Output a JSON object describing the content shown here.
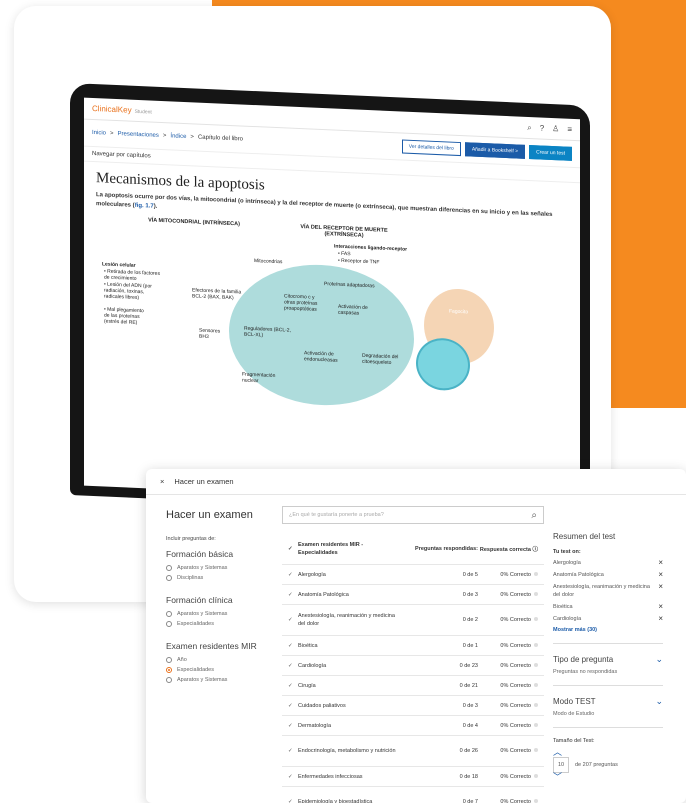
{
  "colors": {
    "orange": "#f58a1f",
    "link": "#1b5ba8",
    "brand": "#e9711c"
  },
  "laptop": {
    "brand": "ClinicalKey",
    "brand_sub": "Student",
    "crumbs": [
      "Inicio",
      ">",
      "Presentaciones",
      ">",
      "Índice",
      ">",
      "Capítulo del libro"
    ],
    "btn_details": "Ver detalles del libro",
    "btn_bookshelf": "Añadir a Bookshelf >",
    "btn_test": "Crear un test",
    "nav": "Navegar por capítulos",
    "title": "Mecanismos de la apoptosis",
    "lead": "La apoptosis ocurre por dos vías, la mitocondrial (o intrínseca) y la del receptor de muerte (o extrínseca), que muestran diferencias en su inicio y en las señales moleculares (",
    "lead_ref": "fig. 1.7",
    "lead_end": ").",
    "figure": {
      "h_intr": "VÍA MITOCONDRIAL (INTRÍNSECA)",
      "h_extr": "VÍA DEL RECEPTOR DE MUERTE (EXTRÍNSECA)",
      "lesion": "Lesión celular",
      "l1": "• Retirada de los factores de crecimiento",
      "l2": "• Lesión del ADN (por radiación, toxinas, radicales libres)",
      "l3": "• Mal plegamiento de las proteínas (estrés del RE)",
      "mito": "Mitocondrias",
      "bcl2": "Efectores de la familia BCL-2 (BAX, BAK)",
      "citoc": "Citocromo c y otras proteínas proapoptóticas",
      "sens": "Sensores BH3",
      "reg": "Reguladores (BCL-2, BCL-XL)",
      "ligand": "Interacciones ligando-receptor",
      "fas": "• FAS",
      "tnf": "• Receptor de TNF",
      "adapt": "Proteínas adaptadoras",
      "activ": "Activación de caspasas",
      "endo": "Activación de endonucleasas",
      "frag": "Fragmentación nuclear",
      "degr": "Degradación del citoesqueleto",
      "fago": "Fagocito"
    }
  },
  "panel": {
    "close": "×",
    "header": "Hacer un examen",
    "title": "Hacer un examen",
    "include": "Incluir preguntas de:",
    "sec1": "Formación básica",
    "sec1_opts": [
      "Aparatos y Sistemas",
      "Disciplinas"
    ],
    "sec2": "Formación clínica",
    "sec2_opts": [
      "Aparatos y Sistemas",
      "Especialidades"
    ],
    "sec3": "Examen residentes MIR",
    "sec3_opts": [
      "Año",
      "Especialidades",
      "Aparatos y Sistemas"
    ],
    "search_placeholder": "¿En qué te gustaría ponerte a prueba?",
    "table_head": {
      "name": "Examen residentes MIR - Especialidades",
      "answered": "Preguntas respondidas:",
      "correct": "Respuesta correcta"
    },
    "rows": [
      {
        "name": "Alergología",
        "answered": "0 de 5",
        "correct": "0% Correcto"
      },
      {
        "name": "Anatomía Patológica",
        "answered": "0 de 3",
        "correct": "0% Correcto"
      },
      {
        "name": "Anestesiología, reanimación y medicina del dolor",
        "answered": "0 de 2",
        "correct": "0% Correcto"
      },
      {
        "name": "Bioética",
        "answered": "0 de 1",
        "correct": "0% Correcto"
      },
      {
        "name": "Cardiología",
        "answered": "0 de 23",
        "correct": "0% Correcto"
      },
      {
        "name": "Cirugía",
        "answered": "0 de 21",
        "correct": "0% Correcto"
      },
      {
        "name": "Cuidados paliativos",
        "answered": "0 de 3",
        "correct": "0% Correcto"
      },
      {
        "name": "Dermatología",
        "answered": "0 de 4",
        "correct": "0% Correcto"
      },
      {
        "name": "Endocrinología, metabolismo y nutrición",
        "answered": "0 de 26",
        "correct": "0% Correcto"
      },
      {
        "name": "Enfermedades infecciosas",
        "answered": "0 de 18",
        "correct": "0% Correcto"
      },
      {
        "name": "Epidemiología y bioestadística",
        "answered": "0 de 7",
        "correct": "0% Correcto"
      }
    ],
    "summary": {
      "title": "Resumen del test",
      "on": "Tu test on:",
      "items": [
        "Alergología",
        "Anatomía Patológica",
        "Anestesiología, reanimación y medicina del dolor",
        "Bioética",
        "Cardiología"
      ],
      "more": "Mostrar más (30)",
      "type_h": "Tipo de pregunta",
      "type_v": "Preguntas no respondidas",
      "mode_h": "Modo TEST",
      "mode_v": "Modo de Estudio",
      "size_h": "Tamaño del Test:",
      "size_v": "10",
      "size_of": "de 207 preguntas"
    }
  }
}
